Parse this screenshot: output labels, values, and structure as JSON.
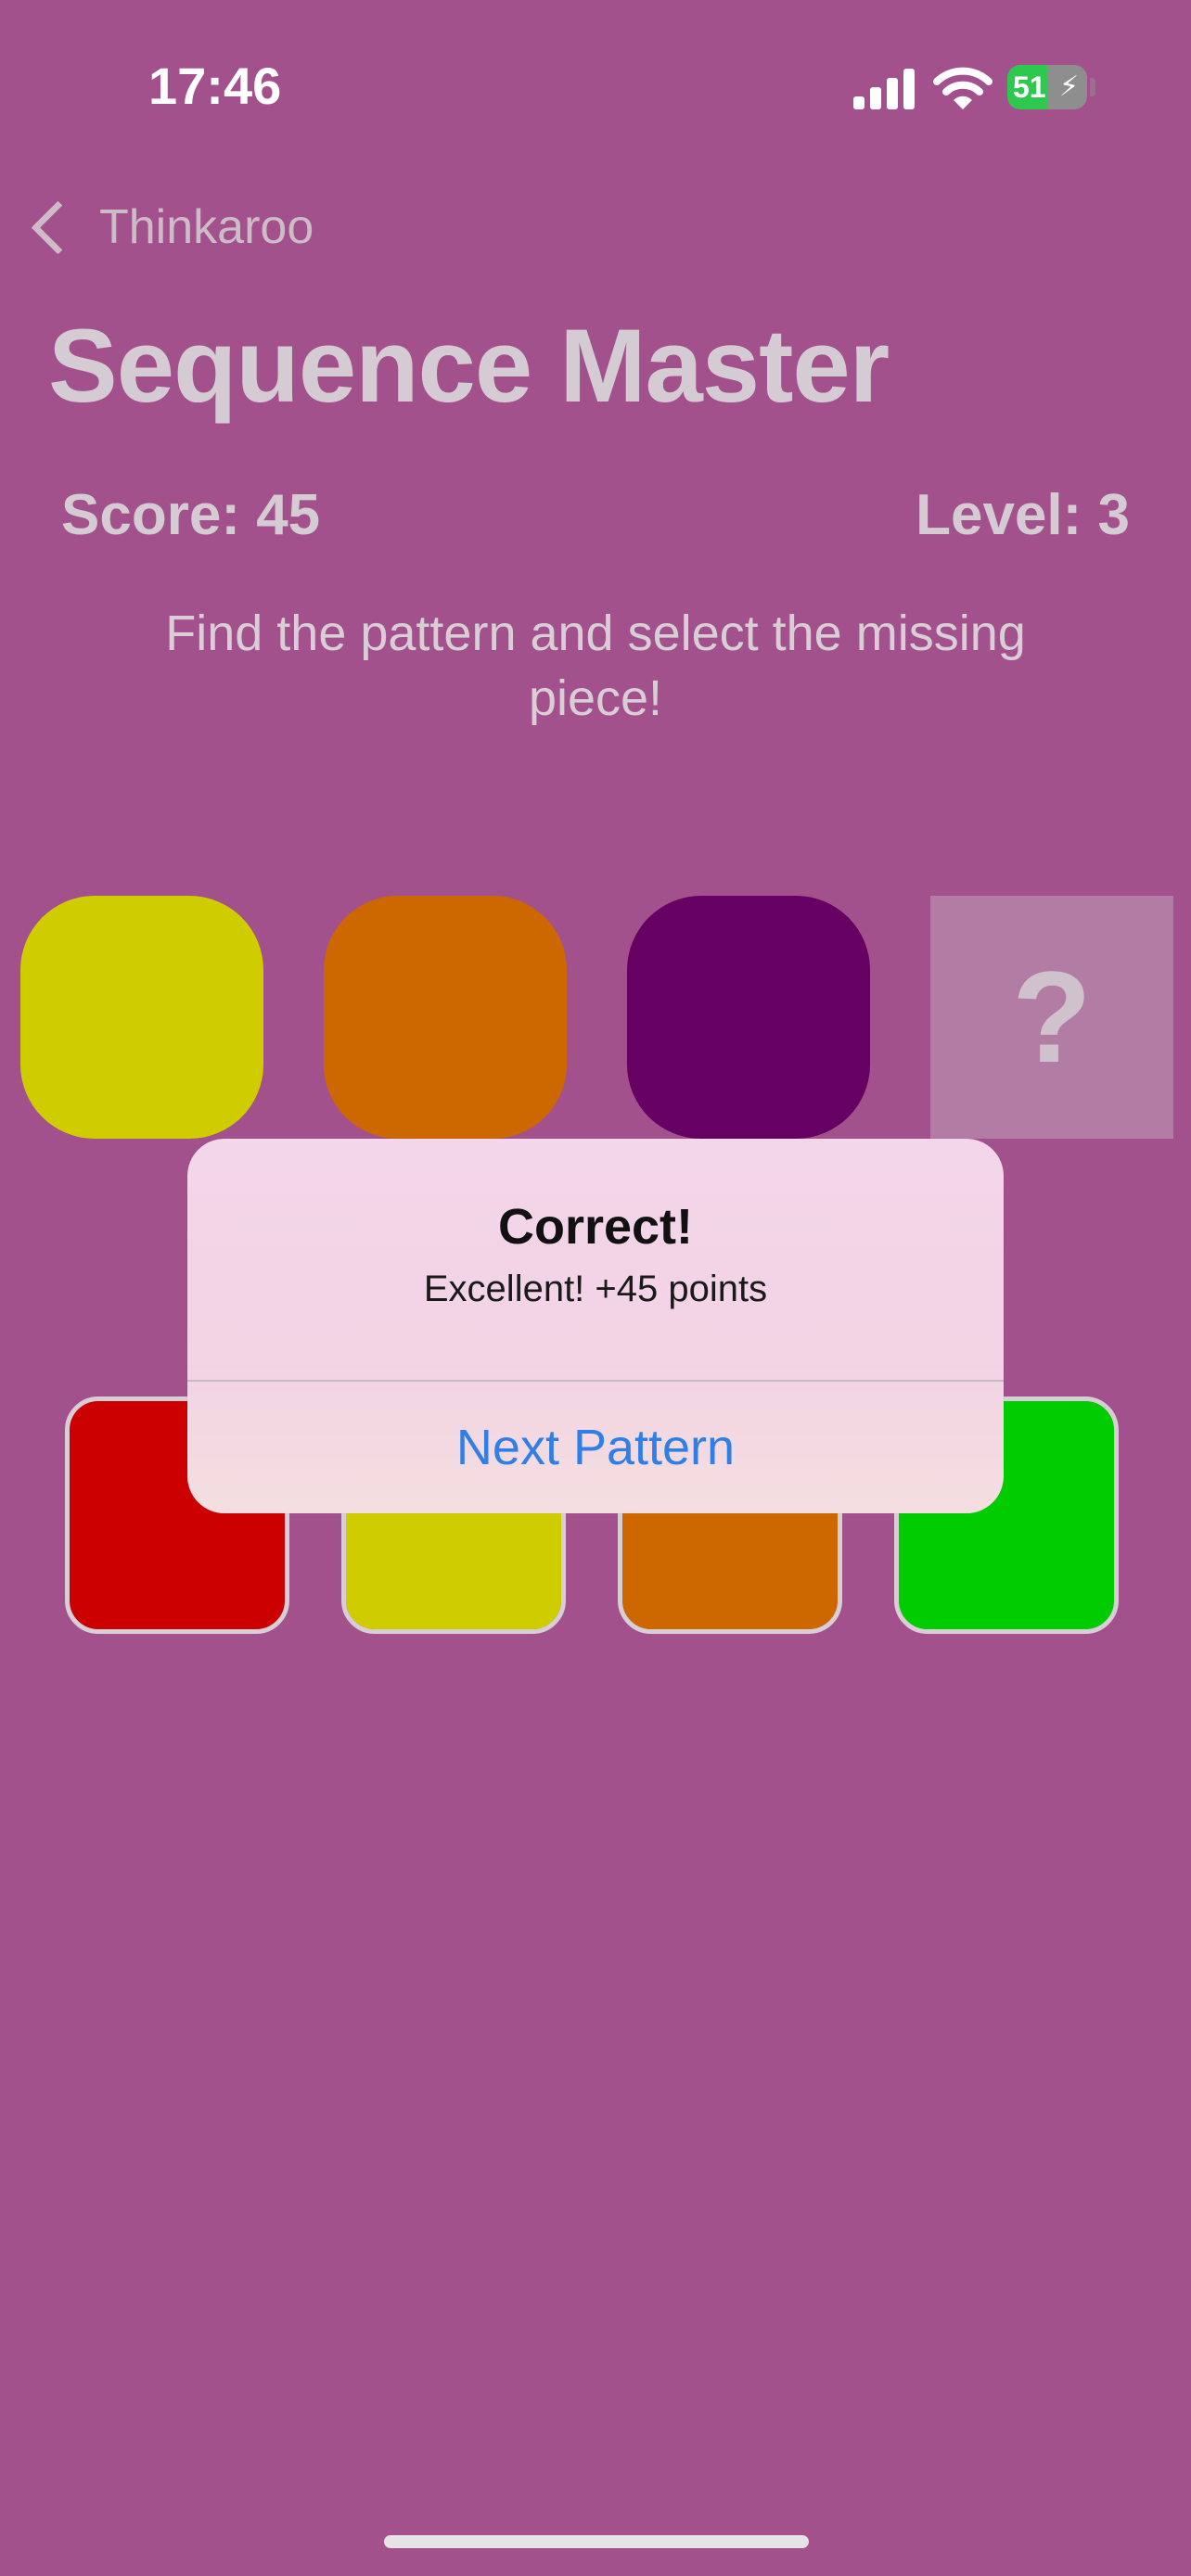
{
  "status_bar": {
    "time": "17:46",
    "battery": "51",
    "battery_level": 0.51
  },
  "nav": {
    "back_label": "Thinkaroo"
  },
  "title": "Sequence Master",
  "stats": {
    "score": "Score: 45",
    "level": "Level: 3"
  },
  "instructions": "Find the pattern and select the missing piece!",
  "sequence": {
    "tiles": [
      "#cfcd00",
      "#cd6800",
      "#660062"
    ],
    "missing_symbol": "?"
  },
  "options": [
    "#cc0000",
    "#cfcd00",
    "#cd6800",
    "#00cc00"
  ],
  "alert": {
    "title": "Correct!",
    "message": "Excellent! +45 points",
    "button": "Next Pattern"
  },
  "colors": {
    "background": "#a2518d",
    "accent": "#2f7fe6"
  }
}
